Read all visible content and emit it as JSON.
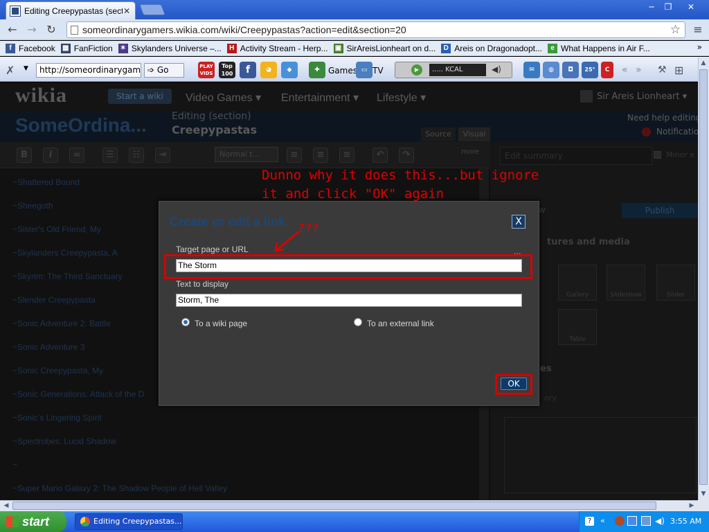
{
  "browser": {
    "tab_title": "Editing Creepypastas (sectio",
    "tab_close": "✕",
    "window_controls": [
      "─",
      "❐",
      "✕"
    ],
    "url": "someordinarygamers.wikia.com/wiki/Creepypastas?action=edit&section=20",
    "bookmarks": [
      {
        "label": "Facebook",
        "color": "#3b5998",
        "glyph": "f"
      },
      {
        "label": "FanFiction",
        "color": "#334466",
        "glyph": "▦"
      },
      {
        "label": "Skylanders Universe –...",
        "color": "#4b3a8a",
        "glyph": "✶"
      },
      {
        "label": "Activity Stream - Herp...",
        "color": "#b51a1a",
        "glyph": "H"
      },
      {
        "label": "SirAreisLionheart on d...",
        "color": "#4a7b2e",
        "glyph": "▣"
      },
      {
        "label": "Areis on Dragonadopt...",
        "color": "#2a5fb3",
        "glyph": "D"
      },
      {
        "label": "What Happens in Air F...",
        "color": "#3b9a3b",
        "glyph": "e"
      }
    ],
    "bookmarks_more": "»"
  },
  "addon_toolbar": {
    "url": "http://someordinarygam",
    "go_label": "Go",
    "games_label": "Games",
    "tv_label": "TV",
    "radio_station": "..... KCAL",
    "play_vids": "PLAY VIDS",
    "top100": "Top 100",
    "weather": "25°"
  },
  "wikia": {
    "logo": "wikia",
    "start_wiki": "Start a wiki",
    "nav": [
      "Video Games ▾",
      "Entertainment ▾",
      "Lifestyle ▾"
    ],
    "user": "Sir Areis Lionheart ▾",
    "wiki_name": "SomeOrdina...",
    "editing_section": "Editing (section)",
    "page_title": "Creepypastas",
    "help": "Need help editing?",
    "notifications": "Notifications",
    "source_tab": "Source",
    "visual_tab": "Visual",
    "paragraph_format": "Normal t...",
    "more": "more",
    "edit_summary": "Edit summary",
    "minor_edit": "Minor e",
    "publish": "Publish",
    "preview": "w",
    "pictures_media": "tures and media",
    "gallery": "Gallery",
    "slideshow": "Slideshow",
    "slider": "Slider",
    "table": "Table",
    "categories": "es",
    "category_placeholder": "ory"
  },
  "editor_lines": [
    "~Shattered Bound",
    "~Sheegoth",
    "~Sister's Old Friend, My",
    "~Skylanders Creepypasta, A",
    "~Skyrim: The Third Sanctuary",
    "~Slender Creepypasta",
    "~Sonic Adventure 2: Battle",
    "~Sonic Adventure 3",
    "~Sonic Creepypasta, My",
    "~Sonic Generations: Attack of the D",
    "~Sonic's Lingering Spirit",
    "~Spectrobes: Lucid Shadow",
    "~",
    "~Super Mario Galaxy 2: The Shadow People of Hell Valley"
  ],
  "dialog": {
    "title": "Create or edit a link",
    "close": "X",
    "target_label": "Target page or URL",
    "target_value": "The Storm",
    "display_label": "Text to display",
    "display_value": "Storm, The",
    "radio_wiki": "To a wiki page",
    "radio_external": "To an external link",
    "radio_selected": "wiki",
    "ok": "OK",
    "dots": "..."
  },
  "annotations": {
    "line1": "Dunno why it does this...but ignore",
    "line2": "it and click \"OK\" again",
    "question": "???",
    "color": "#e00000"
  },
  "taskbar": {
    "start": "start",
    "task": "Editing Creepypastas...",
    "clock": "3:55 AM"
  }
}
